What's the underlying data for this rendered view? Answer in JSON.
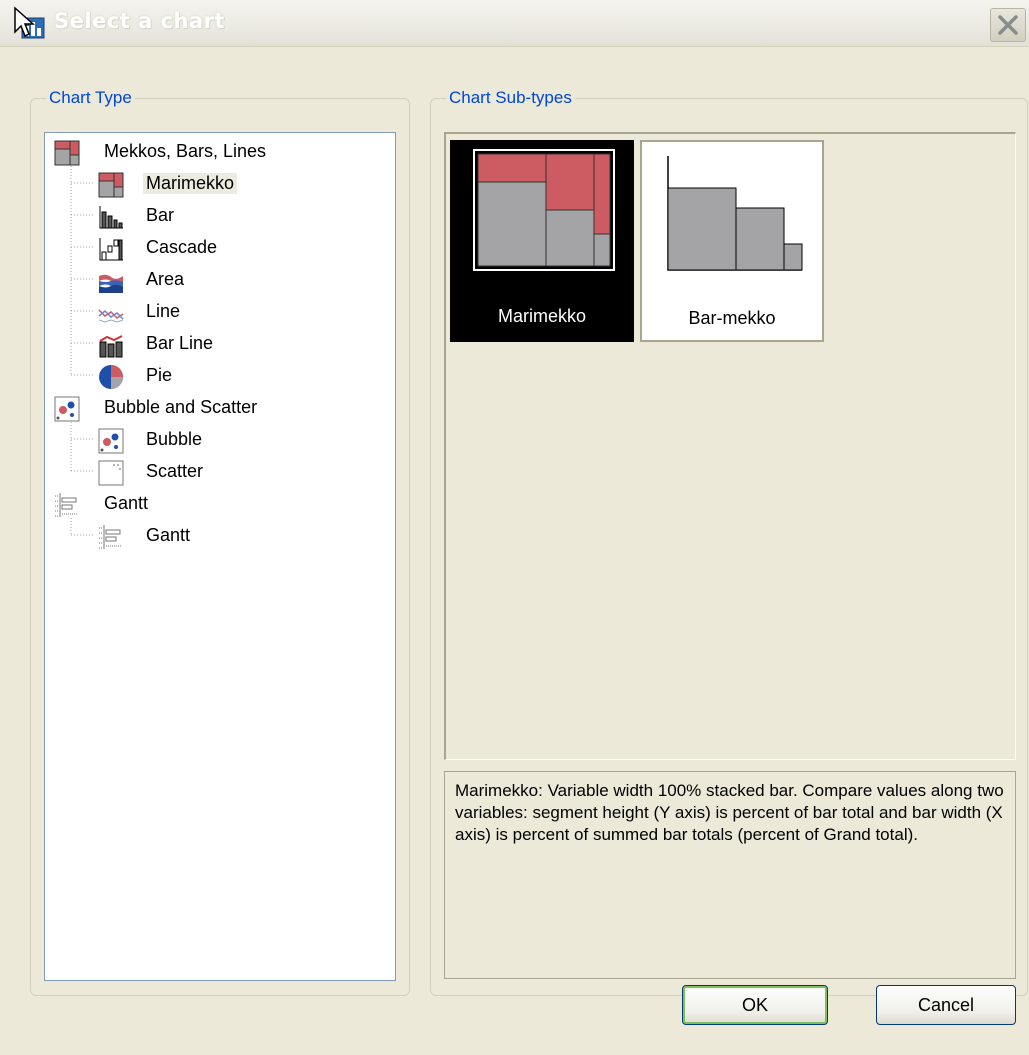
{
  "window": {
    "title": "Select a chart",
    "close_icon": "close-icon"
  },
  "chart_type": {
    "legend": "Chart Type",
    "tree": [
      {
        "label": "Mekkos, Bars, Lines",
        "level": 0,
        "icon": "mekko-icon"
      },
      {
        "label": "Marimekko",
        "level": 1,
        "icon": "marimekko-icon",
        "selected": true
      },
      {
        "label": "Bar",
        "level": 1,
        "icon": "bar-chart-icon"
      },
      {
        "label": "Cascade",
        "level": 1,
        "icon": "cascade-icon"
      },
      {
        "label": "Area",
        "level": 1,
        "icon": "area-chart-icon"
      },
      {
        "label": "Line",
        "level": 1,
        "icon": "line-chart-icon"
      },
      {
        "label": "Bar Line",
        "level": 1,
        "icon": "bar-line-icon"
      },
      {
        "label": "Pie",
        "level": 1,
        "icon": "pie-chart-icon"
      },
      {
        "label": "Bubble and Scatter",
        "level": 0,
        "icon": "bubble-icon"
      },
      {
        "label": "Bubble",
        "level": 1,
        "icon": "bubble-icon"
      },
      {
        "label": "Scatter",
        "level": 1,
        "icon": "scatter-icon"
      },
      {
        "label": "Gantt",
        "level": 0,
        "icon": "gantt-icon"
      },
      {
        "label": "Gantt",
        "level": 1,
        "icon": "gantt-icon"
      }
    ]
  },
  "chart_subtypes": {
    "legend": "Chart Sub-types",
    "items": [
      {
        "label": "Marimekko",
        "icon": "marimekko-preview",
        "selected": true
      },
      {
        "label": "Bar-mekko",
        "icon": "bar-mekko-preview",
        "selected": false
      }
    ],
    "description": "Marimekko: Variable width 100% stacked bar.  Compare values along two variables:  segment height (Y axis) is percent of bar total and bar width (X axis) is percent of summed bar totals (percent of Grand total)."
  },
  "buttons": {
    "ok": "OK",
    "cancel": "Cancel"
  },
  "colors": {
    "accent_red": "#cc5b62",
    "segment_gray": "#a4a3a6",
    "legend_blue": "#0046d5"
  }
}
